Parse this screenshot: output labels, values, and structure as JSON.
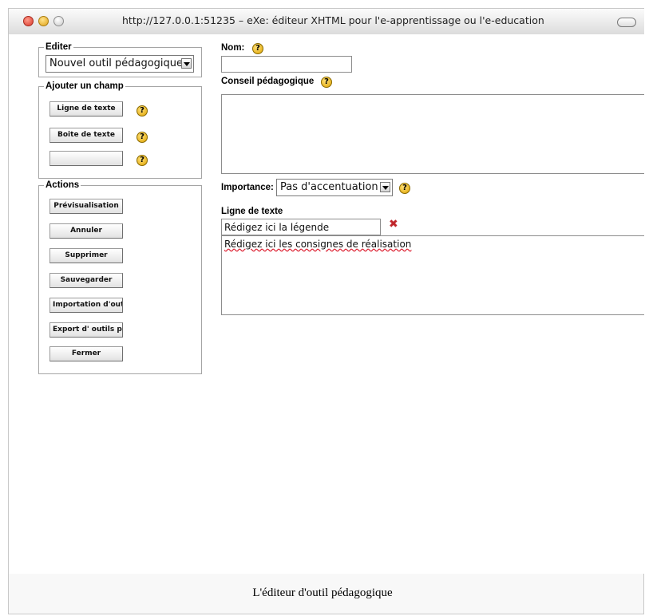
{
  "window": {
    "title": "http://127.0.0.1:51235 – eXe: éditeur XHTML pour l'e-apprentissage ou l'e-education"
  },
  "sidebar": {
    "edit_legend": "Editer",
    "tool_select_value": "Nouvel outil pédagogique",
    "add_field_legend": "Ajouter un champ",
    "add_field_buttons": [
      "Ligne de texte",
      "Boite de texte",
      ""
    ],
    "actions_legend": "Actions",
    "action_buttons": [
      "Prévisualisation",
      "Annuler",
      "Supprimer",
      "Sauvegarder",
      "Importation d'outi",
      "Export d' outils péd",
      "Fermer"
    ]
  },
  "main": {
    "name_label": "Nom:",
    "name_value": "",
    "advice_label": "Conseil pédagogique",
    "advice_value": "",
    "importance_label": "Importance:",
    "importance_value": "Pas d'accentuation",
    "field_section_label": "Ligne de texte",
    "caption_value": "Rédigez ici la légende",
    "instructions_value": "Rédigez ici les consignes de réalisation"
  },
  "icons": {
    "help": "?",
    "delete": "✖"
  },
  "caption": "L'éditeur d'outil pédagogique"
}
